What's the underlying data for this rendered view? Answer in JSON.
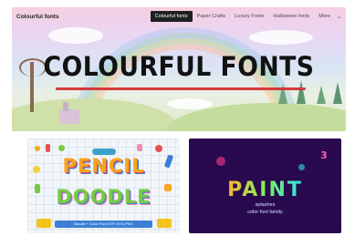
{
  "header": {
    "brand": "Colourful fonts",
    "nav": [
      {
        "label": "Colourful fonts",
        "active": true
      },
      {
        "label": "Paper Crafts",
        "active": false
      },
      {
        "label": "Luxury Fonts",
        "active": false
      },
      {
        "label": "Halloween fonts",
        "active": false
      },
      {
        "label": "More",
        "active": false
      }
    ]
  },
  "hero": {
    "title": "COLOURFUL FONTS",
    "accent_color": "#d63a3a"
  },
  "cards": [
    {
      "title_line1": "PENCIL",
      "title_line2": "DOODLE",
      "caption": "Bundle + Color Font OTF-SVG-PNG"
    },
    {
      "title": "PAINT",
      "badge_number": "3",
      "subtitle_line1": "splashes",
      "subtitle_line2": "color font family"
    }
  ]
}
